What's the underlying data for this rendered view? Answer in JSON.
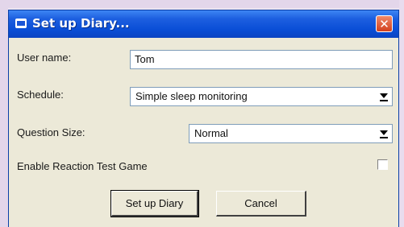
{
  "window": {
    "title": "Set up Diary...",
    "close_glyph": "✕"
  },
  "form": {
    "user_name_label": "User name:",
    "user_name_value": "Tom",
    "schedule_label": "Schedule:",
    "schedule_value": "Simple sleep monitoring",
    "question_size_label": "Question Size:",
    "question_size_value": "Normal",
    "reaction_game_label": "Enable Reaction Test Game",
    "reaction_game_checked": false
  },
  "buttons": {
    "setup_label": "Set up Diary",
    "cancel_label": "Cancel"
  },
  "colors": {
    "titlebar": "#0a4ed6",
    "close": "#d2401e",
    "dialog_bg": "#ece9d8"
  }
}
